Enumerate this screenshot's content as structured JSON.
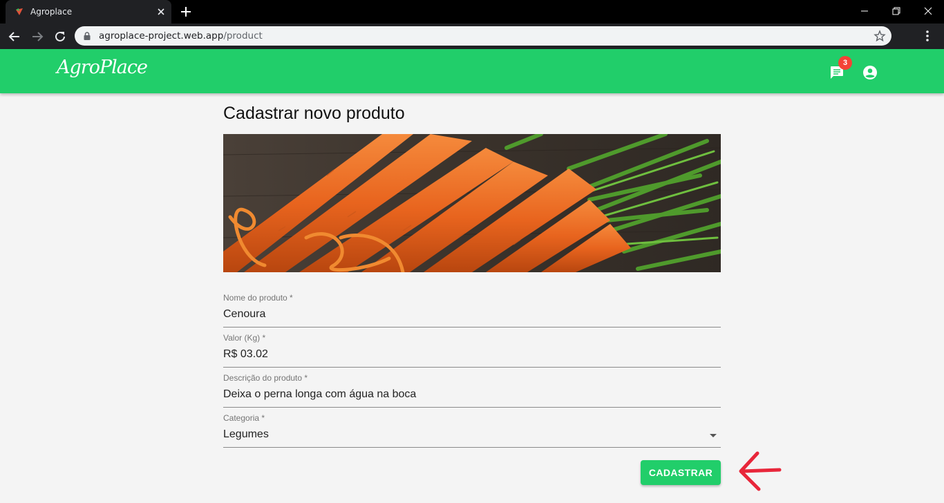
{
  "browser": {
    "tab_title": "Agroplace",
    "url_host": "agroplace-project.web.app",
    "url_path": "/product"
  },
  "app": {
    "logo": "AgroPlace",
    "brand_color": "#21ce6a",
    "notifications_count": "3"
  },
  "main": {
    "title": "Cadastrar novo produto",
    "image_icon": "carrots-photo",
    "form": {
      "name": {
        "label": "Nome do produto *",
        "value": "Cenoura"
      },
      "price": {
        "label": "Valor (Kg) *",
        "value": "R$ 03.02"
      },
      "description": {
        "label": "Descrição do produto *",
        "value": "Deixa o perna longa com água na boca"
      },
      "category": {
        "label": "Categoria *",
        "value": "Legumes"
      }
    },
    "submit_label": "CADASTRAR",
    "annotation_color": "#e8263a"
  }
}
